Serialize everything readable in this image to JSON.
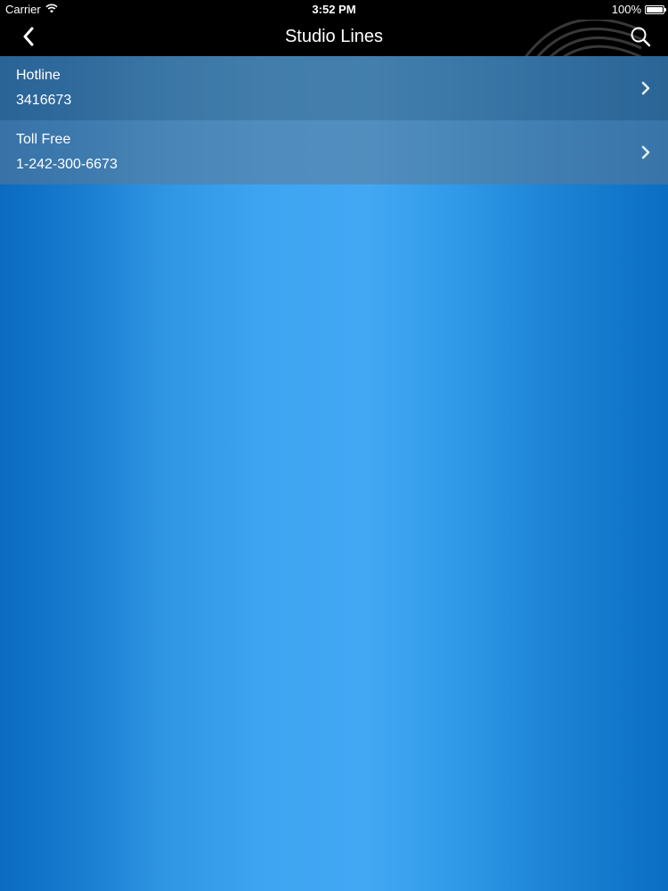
{
  "status_bar": {
    "carrier": "Carrier",
    "time": "3:52 PM",
    "battery": "100%",
    "icons": [
      "wifi-icon",
      "battery-icon"
    ]
  },
  "nav": {
    "title": "Studio Lines",
    "back_icon": "chevron-left-icon",
    "search_icon": "search-icon"
  },
  "lines": [
    {
      "title": "Hotline",
      "number": "3416673"
    },
    {
      "title": "Toll Free",
      "number": "1-242-300-6673"
    }
  ],
  "colors": {
    "bar_background": "#000000",
    "background_dark": "#0a6bc0",
    "background_light": "#42a8f4"
  }
}
